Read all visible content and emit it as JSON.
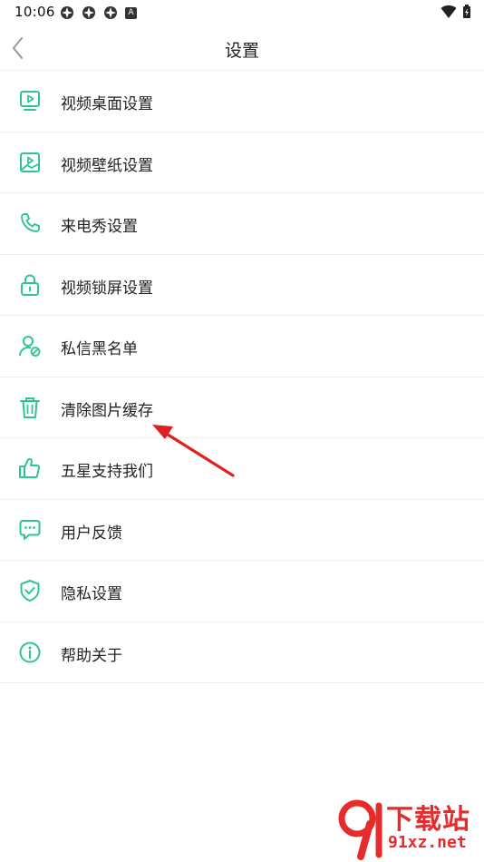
{
  "status_bar": {
    "time": "10:06",
    "badge": "A"
  },
  "header": {
    "title": "设置"
  },
  "settings": [
    {
      "label": "视频桌面设置",
      "icon": "video-desktop-icon"
    },
    {
      "label": "视频壁纸设置",
      "icon": "video-wallpaper-icon"
    },
    {
      "label": "来电秀设置",
      "icon": "phone-icon"
    },
    {
      "label": "视频锁屏设置",
      "icon": "lock-icon"
    },
    {
      "label": "私信黑名单",
      "icon": "user-block-icon"
    },
    {
      "label": "清除图片缓存",
      "icon": "trash-icon"
    },
    {
      "label": "五星支持我们",
      "icon": "thumbs-up-icon"
    },
    {
      "label": "用户反馈",
      "icon": "feedback-icon"
    },
    {
      "label": "隐私设置",
      "icon": "shield-check-icon"
    },
    {
      "label": "帮助关于",
      "icon": "info-icon"
    }
  ],
  "colors": {
    "accent": "#2ec592",
    "annotation": "#e02020"
  },
  "watermark": {
    "top": "下载站",
    "bottom": "91xz.net"
  }
}
